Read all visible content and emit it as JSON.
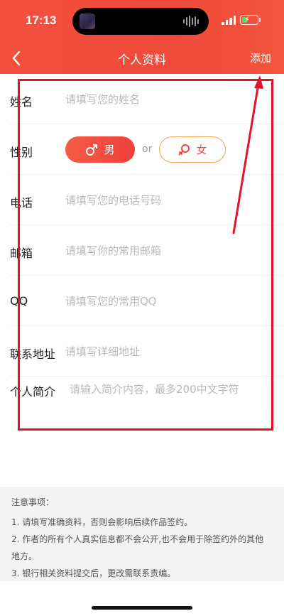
{
  "status_bar": {
    "time": "17:13",
    "battery_level": 0.35,
    "battery_color": "#4cd964"
  },
  "nav": {
    "back_icon": "chevron-left-icon",
    "title": "个人资料",
    "action_label": "添加"
  },
  "form": {
    "name": {
      "label": "姓名",
      "placeholder": "请填写您的姓名",
      "value": ""
    },
    "gender": {
      "label": "性别",
      "male_label": "男",
      "or_text": "or",
      "female_label": "女",
      "selected": "男"
    },
    "phone": {
      "label": "电话",
      "placeholder": "请填写您的电话号码",
      "value": ""
    },
    "email": {
      "label": "邮箱",
      "placeholder": "请填写你的常用邮箱",
      "value": ""
    },
    "qq": {
      "label": "QQ",
      "placeholder": "请填写您的常用QQ",
      "value": ""
    },
    "address": {
      "label": "联系地址",
      "placeholder": "请填写详细地址",
      "value": ""
    },
    "intro": {
      "label": "个人简介",
      "placeholder": "请输入简介内容，最多200中文字符",
      "value": ""
    }
  },
  "notice": {
    "title": "注意事项：",
    "lines": [
      "1. 请填写准确资料，否则会影响后续作品签约。",
      "2. 作者的所有个人真实信息都不会公开,也不会用于除签约外的其他",
      "地方。",
      "3. 银行相关资料提交后，更改需联系责编。"
    ]
  },
  "colors": {
    "header_red": "#f04a3a",
    "annotation_red": "#e01628",
    "female_border": "#f3a24b"
  }
}
